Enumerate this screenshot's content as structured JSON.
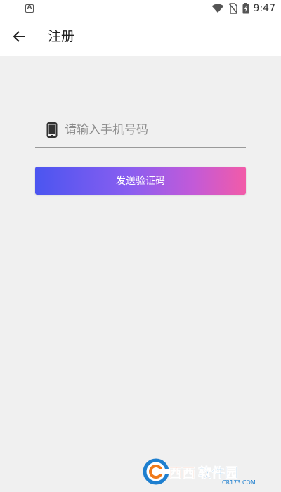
{
  "status_bar": {
    "time": "9:47",
    "left_icon": "A"
  },
  "header": {
    "title": "注册"
  },
  "form": {
    "phone_placeholder": "请输入手机号码",
    "phone_value": "",
    "send_code_label": "发送验证码"
  },
  "watermark": {
    "text": "西西软件园",
    "subtext": "CR173.COM"
  },
  "colors": {
    "gradient_start": "#4b55f0",
    "gradient_end": "#f25ba8",
    "background": "#f0f0f0"
  },
  "icons": [
    "wifi-icon",
    "no-sim-icon",
    "battery-charging-icon",
    "back-arrow-icon",
    "phone-icon"
  ]
}
